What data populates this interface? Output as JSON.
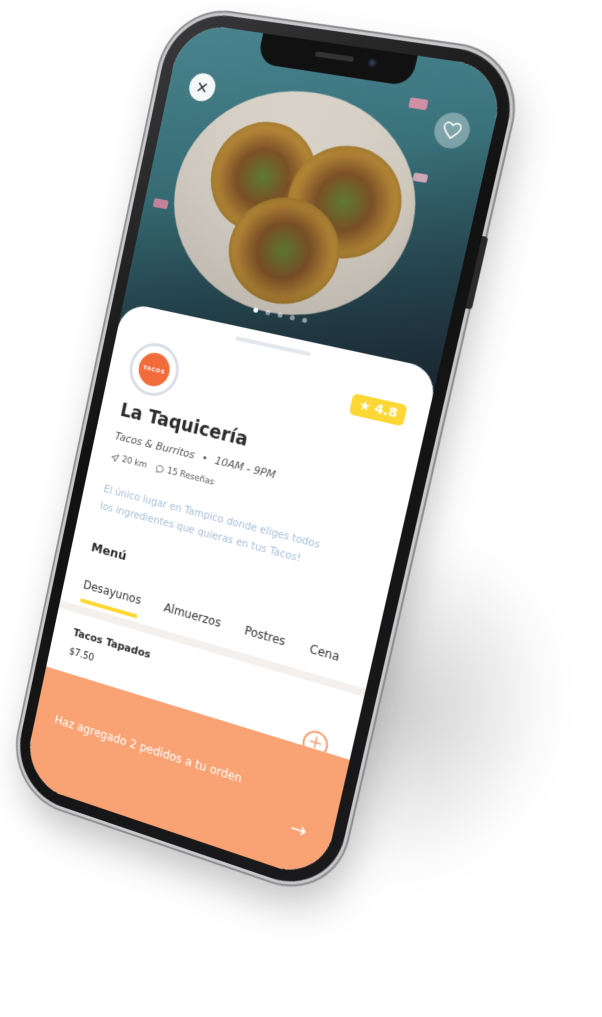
{
  "app": {
    "accent": "#f9a273",
    "rating_color": "#fdd835"
  },
  "hero": {
    "close_icon": "close-icon",
    "favorite_icon": "heart-icon",
    "slides_count": 5,
    "active_slide": 1
  },
  "restaurant": {
    "logo_text": "TACOS",
    "rating": "4.8",
    "name": "La Taquicería",
    "category": "Tacos & Burritos",
    "hours": "10AM - 9PM",
    "distance": "20 km",
    "reviews": "15 Reseñas",
    "description": "El único lugar en Tampico donde eliges todos los ingredientes que quieras en tus Tacos!"
  },
  "menu": {
    "title": "Menú",
    "tabs": [
      "Desayunos",
      "Almuerzos",
      "Postres",
      "Cena"
    ],
    "active_tab": 0,
    "items": [
      {
        "name": "Tacos Tapados",
        "price": "$7.50"
      }
    ]
  },
  "order_bar": {
    "text": "Haz agregado 2 pedidos a tu orden"
  }
}
